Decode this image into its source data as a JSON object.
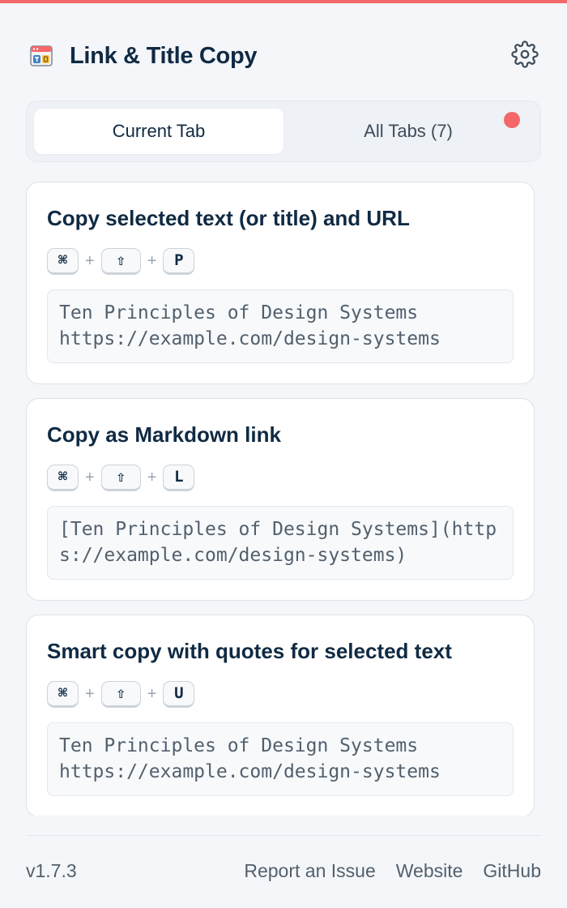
{
  "app": {
    "title": "Link & Title Copy",
    "accent_color": "#f4676a",
    "logo_icon": "browser-window-logo-icon",
    "settings_icon": "gear-icon"
  },
  "tabs": [
    {
      "label": "Current Tab",
      "active": true
    },
    {
      "label": "All Tabs (7)",
      "active": false,
      "has_indicator": true
    }
  ],
  "cards": [
    {
      "title": "Copy selected text (or title) and URL",
      "keys": [
        "⌘",
        "⇧",
        "P"
      ],
      "preview": "Ten Principles of Design Systems\nhttps://example.com/design-systems"
    },
    {
      "title": "Copy as Markdown link",
      "keys": [
        "⌘",
        "⇧",
        "L"
      ],
      "preview": "[Ten Principles of Design Systems](https://example.com/design-systems)"
    },
    {
      "title": "Smart copy with quotes for selected text",
      "keys": [
        "⌘",
        "⇧",
        "U"
      ],
      "preview": "Ten Principles of Design Systems\nhttps://example.com/design-systems"
    }
  ],
  "shortcut_separator": "+",
  "footer": {
    "version": "v1.7.3",
    "links": [
      "Report an Issue",
      "Website",
      "GitHub"
    ]
  }
}
